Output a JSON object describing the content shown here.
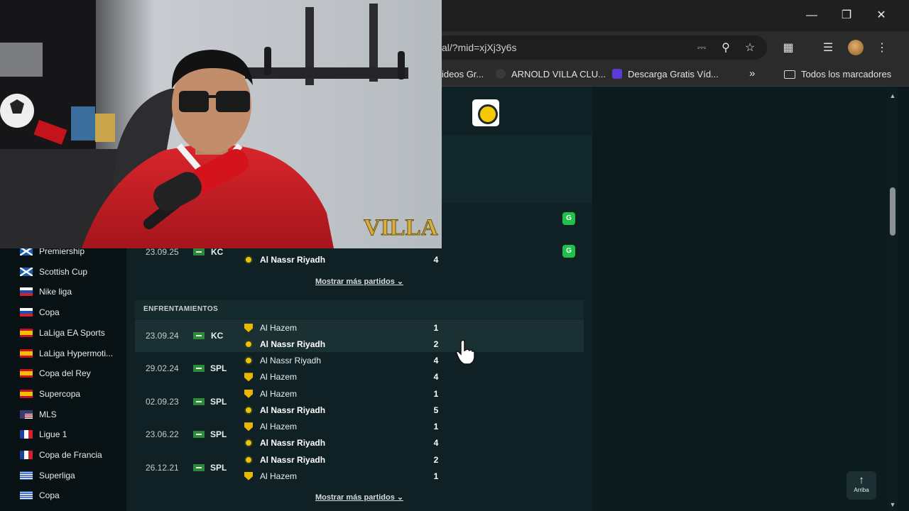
{
  "browser": {
    "url": "al/?mid=xjXj3y6s",
    "bookmarks": [
      {
        "label": "ideos Gr..."
      },
      {
        "label": "ARNOLD VILLA CLU..."
      },
      {
        "label": "Descarga Gratis Víd..."
      }
    ],
    "all_bookmarks_label": "Todos los marcadores",
    "overflow_label": "»"
  },
  "sidebar": {
    "items": [
      {
        "label": "Premiership",
        "flag": "scotland"
      },
      {
        "label": "Scottish Cup",
        "flag": "scotland"
      },
      {
        "label": "Nike liga",
        "flag": "slovenia"
      },
      {
        "label": "Copa",
        "flag": "slovenia"
      },
      {
        "label": "LaLiga EA Sports",
        "flag": "spain"
      },
      {
        "label": "LaLiga Hypermoti...",
        "flag": "spain"
      },
      {
        "label": "Copa del Rey",
        "flag": "spain"
      },
      {
        "label": "Supercopa",
        "flag": "spain"
      },
      {
        "label": "MLS",
        "flag": "usa"
      },
      {
        "label": "Ligue 1",
        "flag": "france"
      },
      {
        "label": "Copa de Francia",
        "flag": "france"
      },
      {
        "label": "Superliga",
        "flag": "greece"
      },
      {
        "label": "Copa",
        "flag": "greece"
      }
    ]
  },
  "form_badges": [
    "G",
    "G"
  ],
  "previous_match": {
    "date": "23.09.25",
    "league": "KC",
    "team": "Al Nassr Riyadh",
    "score": "4"
  },
  "show_more_label": "Mostrar más partidos",
  "h2h": {
    "title": "ENFRENTAMIENTOS",
    "matches": [
      {
        "date": "23.09.24",
        "league": "KC",
        "home": "Al Hazem",
        "home_score": "1",
        "away": "Al Nassr Riyadh",
        "away_score": "2",
        "winner": "away"
      },
      {
        "date": "29.02.24",
        "league": "SPL",
        "home": "Al Nassr Riyadh",
        "home_score": "4",
        "away": "Al Hazem",
        "away_score": "4",
        "winner": "none"
      },
      {
        "date": "02.09.23",
        "league": "SPL",
        "home": "Al Hazem",
        "home_score": "1",
        "away": "Al Nassr Riyadh",
        "away_score": "5",
        "winner": "away"
      },
      {
        "date": "23.06.22",
        "league": "SPL",
        "home": "Al Hazem",
        "home_score": "1",
        "away": "Al Nassr Riyadh",
        "away_score": "4",
        "winner": "away"
      },
      {
        "date": "26.12.21",
        "league": "SPL",
        "home": "Al Nassr Riyadh",
        "home_score": "2",
        "away": "Al Hazem",
        "away_score": "1",
        "winner": "home"
      }
    ],
    "show_more_label": "Mostrar más partidos"
  },
  "scroll_top": {
    "label": "Arriba"
  },
  "webcam": {
    "overlay_brand": "VILLA"
  },
  "colors": {
    "accent_green": "#1fc14b",
    "page_bg": "#0c1b1d",
    "nassr_yellow": "#f2c200"
  }
}
